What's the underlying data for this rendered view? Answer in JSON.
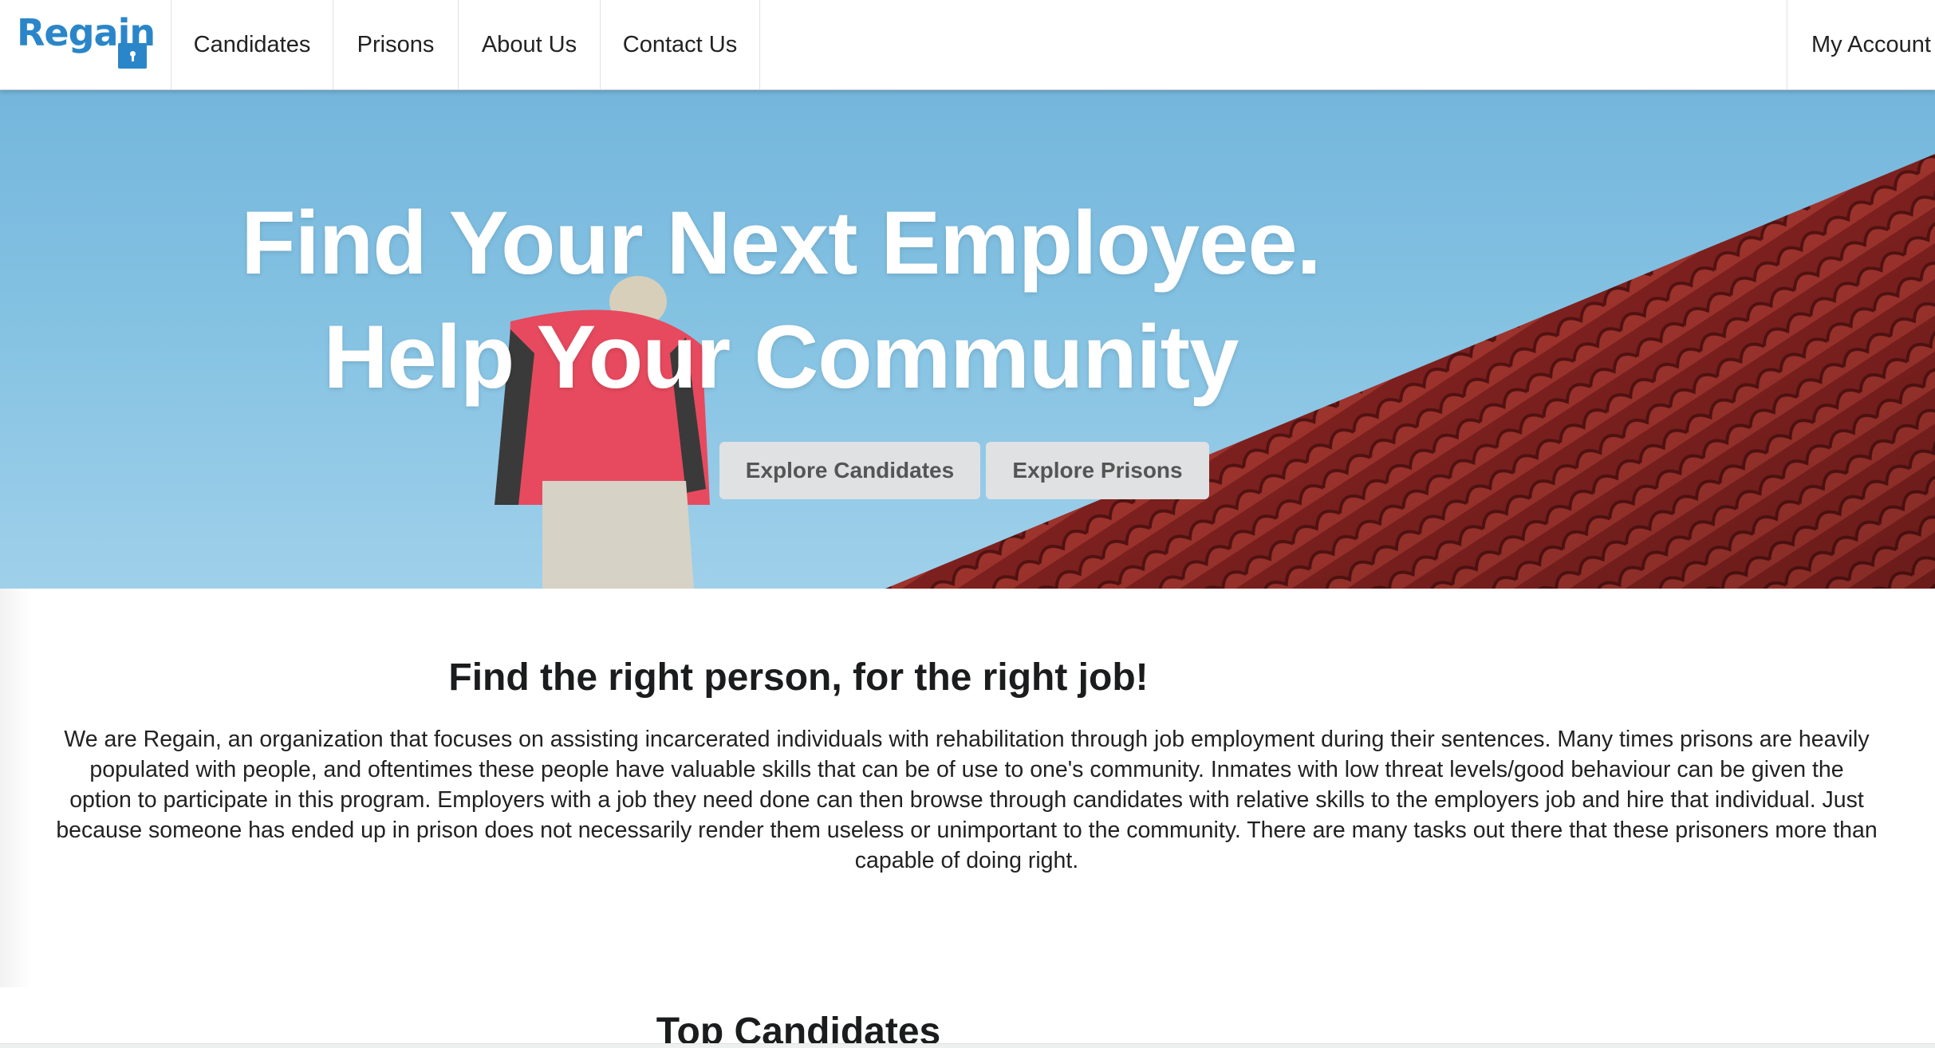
{
  "nav": {
    "brand": "Regain",
    "items": [
      {
        "label": "Candidates"
      },
      {
        "label": "Prisons"
      },
      {
        "label": "About Us"
      },
      {
        "label": "Contact Us"
      }
    ],
    "account": "My Account"
  },
  "hero": {
    "title_line1": "Find Your Next Employee.",
    "title_line2": "Help Your Community",
    "btn_candidates": "Explore Candidates",
    "btn_prisons": "Explore Prisons"
  },
  "about": {
    "title": "Find the right person, for the right job!",
    "text": "We are Regain, an organization that focuses on assisting incarcerated individuals with rehabilitation through job employment during their sentences. Many times prisons are heavily populated with people, and oftentimes these people have valuable skills that can be of use to one's community. Inmates with low threat levels/good behaviour can be given the option to participate in this program. Employers with a job they need done can then browse through candidates with relative skills to the employers job and hire that individual. Just because someone has ended up in prison does not necessarily render them useless or unimportant to the community. There are many tasks out there that these prisoners more than capable of doing right."
  },
  "top_candidates": {
    "title": "Top Candidates"
  },
  "colors": {
    "brand": "#2b86c9",
    "sky": "#86c3e3",
    "roof": "#9e2b28",
    "button_bg": "#e0e1e2"
  }
}
